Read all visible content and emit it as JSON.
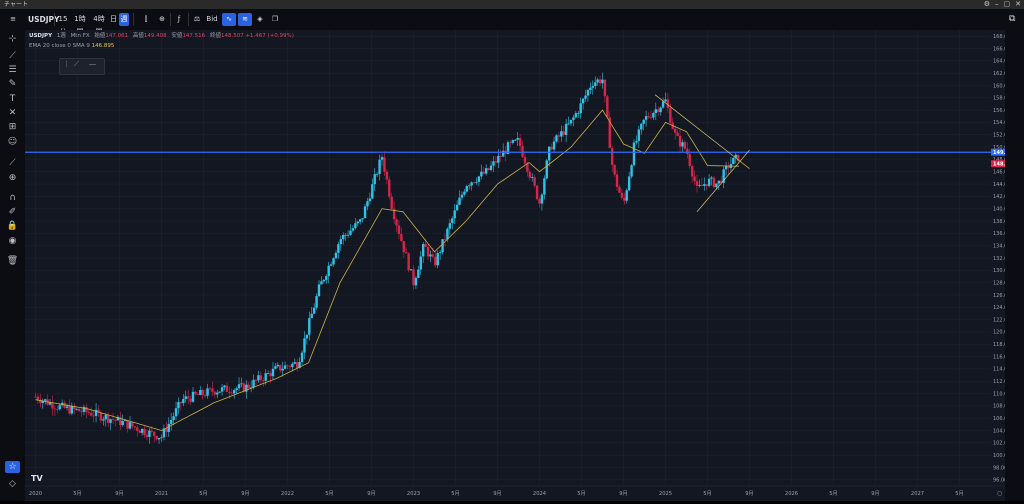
{
  "window": {
    "title": "チャート"
  },
  "toolbar": {
    "symbol": "USDJPY",
    "intervals": [
      "15分",
      "1時間",
      "4時間",
      "日",
      "週"
    ],
    "price_type": "Bid"
  },
  "legend": {
    "symbol": "USDJPY",
    "interval": "1週",
    "source": "Mtn FX",
    "ohlc": [
      {
        "label": "始値",
        "value": "147.061"
      },
      {
        "label": "高値",
        "value": "149.408"
      },
      {
        "label": "安値",
        "value": "147.516"
      },
      {
        "label": "終値",
        "value": "148.507"
      },
      {
        "label": "",
        "value": "+1.467 (+0.99%)"
      }
    ],
    "ema_label": "EMA 20 close 0 SMA 9",
    "ema_value": "146.895"
  },
  "price_axis": {
    "labels": [
      "168.000",
      "166.000",
      "164.000",
      "162.000",
      "160.000",
      "158.000",
      "156.000",
      "154.000",
      "152.000",
      "150.000",
      "148.000",
      "146.000",
      "144.000",
      "142.000",
      "140.000",
      "138.000",
      "136.000",
      "134.000",
      "132.000",
      "130.000",
      "128.000",
      "126.000",
      "124.000",
      "122.000",
      "120.000",
      "118.000",
      "116.000",
      "114.000",
      "112.000",
      "110.000",
      "108.000",
      "106.000",
      "104.000",
      "102.000",
      "100.000",
      "98.000",
      "96.000"
    ],
    "hline_label": "149.165",
    "last_price_label": "148.507"
  },
  "time_axis": {
    "labels": [
      "2020",
      "5月",
      "9月",
      "2021",
      "5月",
      "9月",
      "2022",
      "5月",
      "9月",
      "2023",
      "5月",
      "9月",
      "2024",
      "5月",
      "9月",
      "2025",
      "5月",
      "9月",
      "2026",
      "5月",
      "9月",
      "2027",
      "5月"
    ]
  },
  "colors": {
    "background": "#131722",
    "up": "#2ec4e8",
    "down": "#d6244a",
    "ema": "#c9b14a",
    "hline": "#2f6bff",
    "trend": "#d7c36a"
  },
  "icons": {
    "left": [
      "crosshair-icon",
      "trendline-icon",
      "horizontal-lines-icon",
      "brush-icon",
      "text-icon",
      "pattern-icon",
      "measure-icon",
      "emoji-icon",
      "ruler-icon",
      "zoom-icon",
      "magnet-icon",
      "lock-drawing-icon",
      "lock-icon",
      "eye-icon",
      "trash-icon"
    ]
  },
  "chart_data": {
    "type": "candlestick",
    "symbol": "USDJPY",
    "interval": "1週",
    "ylim": [
      95,
      169
    ],
    "horizontal_line": 149.165,
    "last_price": 148.507,
    "ema_label": "EMA 20",
    "points_interpolated_for_weekly_candles": true,
    "close_path": [
      [
        "2020-01",
        109.5
      ],
      [
        "2020-03",
        108.0
      ],
      [
        "2020-04",
        107.5
      ],
      [
        "2020-06",
        107.0
      ],
      [
        "2020-09",
        105.5
      ],
      [
        "2020-12",
        103.5
      ],
      [
        "2021-01",
        103.0
      ],
      [
        "2021-03",
        109.0
      ],
      [
        "2021-06",
        110.5
      ],
      [
        "2021-09",
        111.0
      ],
      [
        "2021-12",
        114.0
      ],
      [
        "2022-02",
        115.0
      ],
      [
        "2022-04",
        127.0
      ],
      [
        "2022-06",
        135.0
      ],
      [
        "2022-08",
        138.0
      ],
      [
        "2022-10",
        148.5
      ],
      [
        "2022-11",
        140.0
      ],
      [
        "2023-01",
        128.0
      ],
      [
        "2023-02",
        134.0
      ],
      [
        "2023-03",
        131.0
      ],
      [
        "2023-06",
        144.0
      ],
      [
        "2023-08",
        146.0
      ],
      [
        "2023-10",
        150.0
      ],
      [
        "2023-11",
        151.0
      ],
      [
        "2024-01",
        141.0
      ],
      [
        "2024-02",
        150.0
      ],
      [
        "2024-04",
        154.0
      ],
      [
        "2024-05",
        157.0
      ],
      [
        "2024-06",
        160.5
      ],
      [
        "2024-07",
        161.0
      ],
      [
        "2024-08",
        146.0
      ],
      [
        "2024-09",
        140.5
      ],
      [
        "2024-10",
        150.0
      ],
      [
        "2024-11",
        154.5
      ],
      [
        "2025-01",
        157.5
      ],
      [
        "2025-02",
        151.5
      ],
      [
        "2025-03",
        149.5
      ],
      [
        "2025-04",
        143.0
      ],
      [
        "2025-05",
        144.5
      ],
      [
        "2025-06",
        144.0
      ],
      [
        "2025-07",
        147.0
      ],
      [
        "2025-08",
        148.5
      ]
    ],
    "ema_path": [
      [
        "2020-01",
        109.0
      ],
      [
        "2020-06",
        107.5
      ],
      [
        "2020-12",
        104.5
      ],
      [
        "2021-01",
        104.0
      ],
      [
        "2021-06",
        108.5
      ],
      [
        "2021-12",
        112.5
      ],
      [
        "2022-03",
        115.0
      ],
      [
        "2022-06",
        128.0
      ],
      [
        "2022-10",
        140.0
      ],
      [
        "2022-12",
        139.5
      ],
      [
        "2023-03",
        133.0
      ],
      [
        "2023-06",
        138.0
      ],
      [
        "2023-09",
        144.0
      ],
      [
        "2023-12",
        147.5
      ],
      [
        "2024-01",
        146.0
      ],
      [
        "2024-04",
        150.0
      ],
      [
        "2024-07",
        156.0
      ],
      [
        "2024-09",
        150.5
      ],
      [
        "2024-11",
        149.0
      ],
      [
        "2025-01",
        154.0
      ],
      [
        "2025-03",
        152.5
      ],
      [
        "2025-05",
        147.0
      ],
      [
        "2025-08",
        146.9
      ]
    ],
    "trendlines": [
      {
        "name": "upper",
        "from": [
          "2024-12",
          158.5
        ],
        "to": [
          "2025-09",
          146.5
        ]
      },
      {
        "name": "lower",
        "from": [
          "2025-04",
          139.5
        ],
        "to": [
          "2025-09",
          149.5
        ]
      }
    ]
  }
}
